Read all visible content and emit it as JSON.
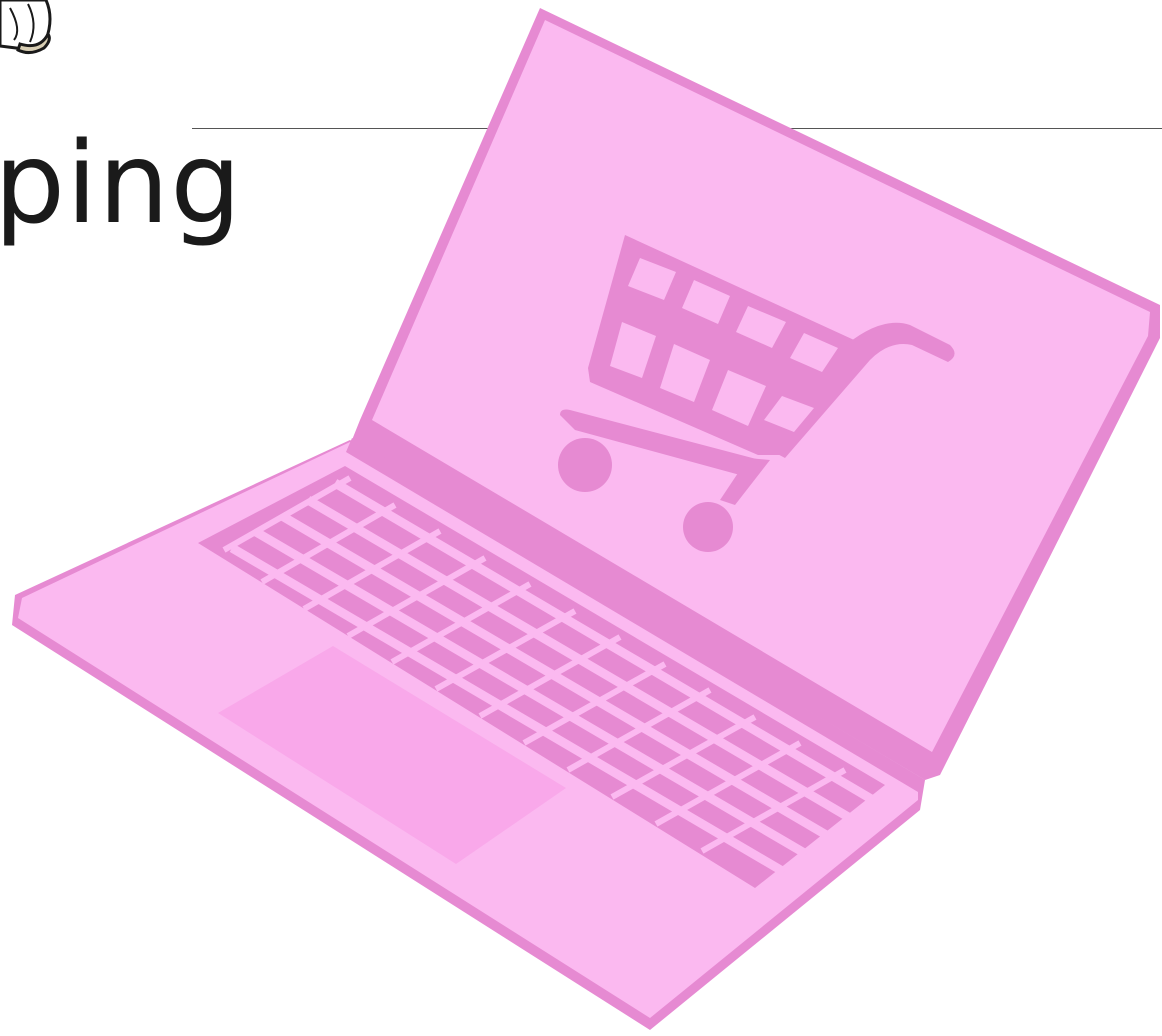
{
  "heading": {
    "visible_text": "ping"
  },
  "colors": {
    "laptop_body": "#fbb9f0",
    "laptop_outline": "#e68ad2",
    "trackpad": "#f9a8ea",
    "text": "#1a1a1a",
    "divider": "#555555"
  },
  "icons": {
    "corner": "paper-roll-icon",
    "screen": "shopping-cart-icon"
  }
}
